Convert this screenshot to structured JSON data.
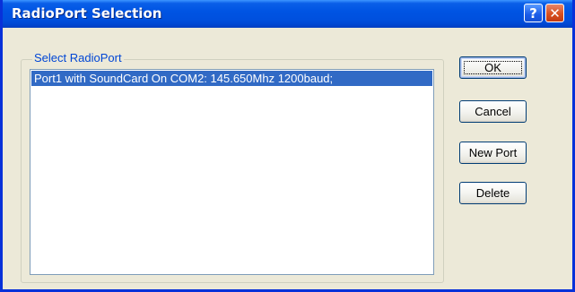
{
  "window": {
    "title": "RadioPort Selection",
    "help_label": "?",
    "close_label": "✕"
  },
  "group": {
    "label": "Select RadioPort",
    "items": [
      {
        "label": "Port1 with SoundCard On COM2: 145.650Mhz 1200baud;",
        "selected": true
      }
    ]
  },
  "buttons": {
    "ok": "OK",
    "cancel": "Cancel",
    "new_port": "New Port",
    "delete": "Delete"
  },
  "colors": {
    "titlebar": "#0054e3",
    "selection": "#316ac5",
    "group_label": "#0046d5",
    "close_button": "#d8501f"
  }
}
